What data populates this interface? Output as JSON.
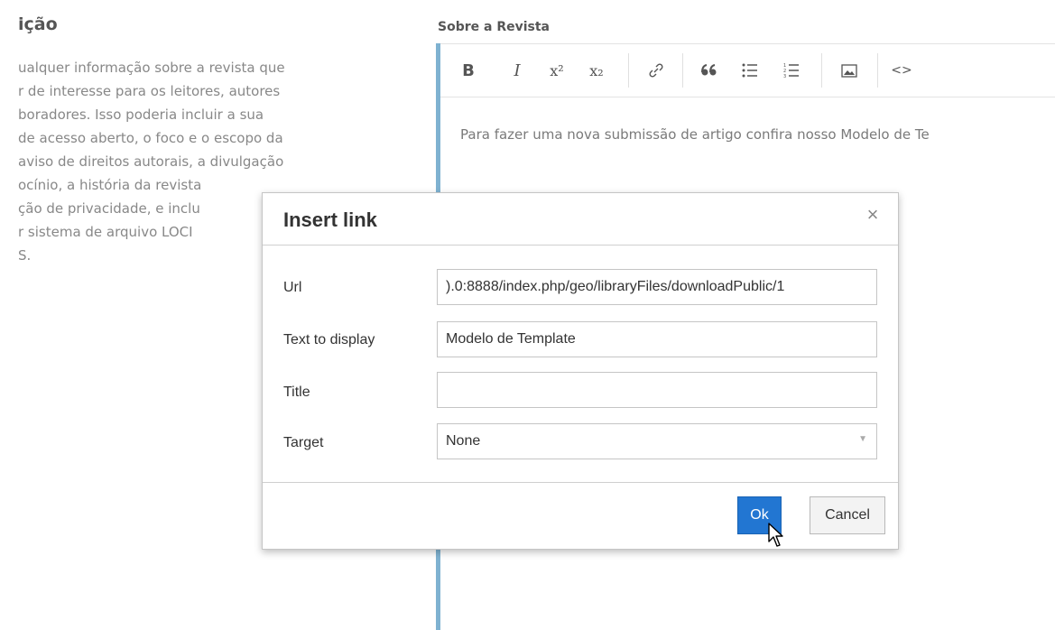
{
  "section": {
    "title": "ição",
    "description_lines": [
      "ualquer informação sobre a revista que",
      "r de interesse para os leitores, autores",
      "boradores. Isso poderia incluir a sua",
      "de acesso aberto, o foco e o escopo da",
      "aviso de direitos autorais, a divulgação",
      "ocínio, a história da revista",
      "ção de privacidade, e inclu",
      "r sistema de arquivo LOCI",
      "S."
    ]
  },
  "editor": {
    "label": "Sobre a Revista",
    "toolbar": [
      {
        "name": "bold-button",
        "glyph": "B"
      },
      {
        "name": "italic-button",
        "glyph": "I"
      },
      {
        "name": "superscript-button",
        "glyph": "x²"
      },
      {
        "name": "subscript-button",
        "glyph": "x₂"
      },
      {
        "name": "link-button",
        "glyph": "🔗"
      },
      {
        "name": "blockquote-button",
        "glyph": "❝"
      },
      {
        "name": "bullet-list-button",
        "glyph": "☰"
      },
      {
        "name": "numbered-list-button",
        "glyph": "☰"
      },
      {
        "name": "image-button",
        "glyph": "▣"
      },
      {
        "name": "source-code-button",
        "glyph": "<>"
      }
    ],
    "content": "Para fazer uma nova submissão de artigo confira nosso Modelo de Te"
  },
  "dialog": {
    "title": "Insert link",
    "close_glyph": "×",
    "url_label": "Url",
    "url_value": ").0:8888/index.php/geo/libraryFiles/downloadPublic/1",
    "text_label": "Text to display",
    "text_value": "Modelo de Template",
    "title_label": "Title",
    "title_value": "",
    "target_label": "Target",
    "target_value": "None",
    "caret": "▼",
    "ok_label": "Ok",
    "cancel_label": "Cancel"
  }
}
